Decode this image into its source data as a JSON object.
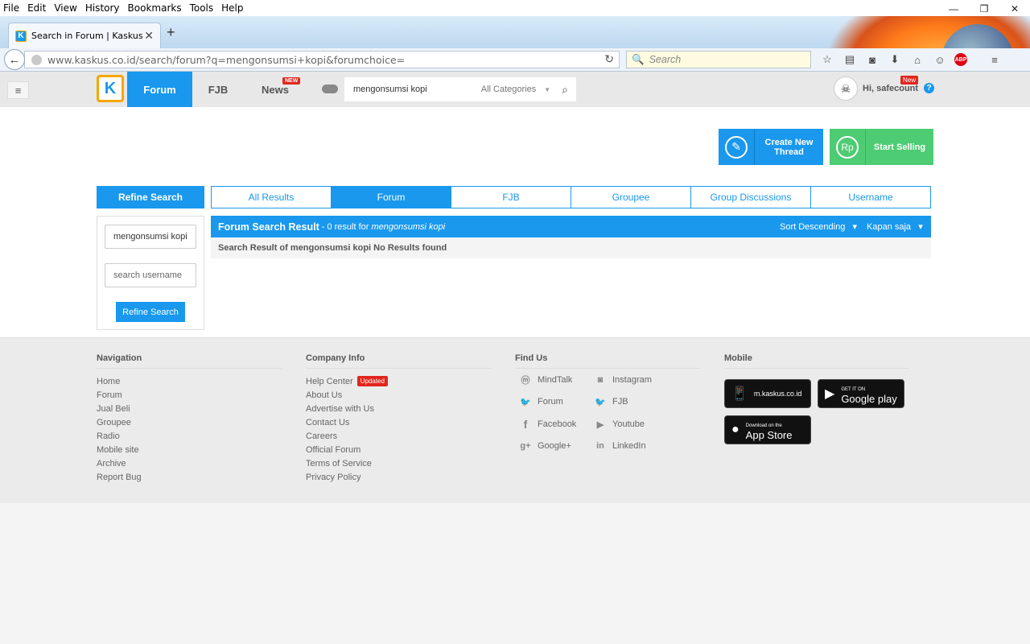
{
  "browser": {
    "menu": [
      "File",
      "Edit",
      "View",
      "History",
      "Bookmarks",
      "Tools",
      "Help"
    ],
    "tab_title": "Search in Forum | Kaskus -...",
    "url": "www.kaskus.co.id/search/forum?q=mengonsumsi+kopi&forumchoice=",
    "search_placeholder": "Search",
    "abp_label": "ABP"
  },
  "header": {
    "logo": "K",
    "nav": [
      "Forum",
      "FJB",
      "News"
    ],
    "new_badge": "NEW",
    "search_query": "mengonsumsi kopi",
    "category": "All Categories",
    "user_greeting": "Hi, safecount",
    "user_badge": "New",
    "help": "?"
  },
  "actions": {
    "create_thread": "Create New Thread",
    "start_selling": "Start Selling",
    "rp": "Rp"
  },
  "refine": {
    "title": "Refine Search",
    "query_value": "mengonsumsi kopi",
    "username_placeholder": "search username",
    "button": "Refine Search"
  },
  "result_tabs": [
    "All Results",
    "Forum",
    "FJB",
    "Groupee",
    "Group Discussions",
    "Username"
  ],
  "results": {
    "title": "Forum Search Result",
    "summary_prefix": "- 0 result for",
    "summary_query": "mengonsumsi kopi",
    "sort": "Sort Descending",
    "time": "Kapan saja",
    "message": "Search Result of mengonsumsi kopi No Results found"
  },
  "footer": {
    "navigation": {
      "title": "Navigation",
      "links": [
        "Home",
        "Forum",
        "Jual Beli",
        "Groupee",
        "Radio",
        "Mobile site",
        "Archive",
        "Report Bug"
      ]
    },
    "company": {
      "title": "Company Info",
      "links": [
        "Help Center",
        "About Us",
        "Advertise with Us",
        "Contact Us",
        "Careers",
        "Official Forum",
        "Terms of Service",
        "Privacy Policy"
      ],
      "updated_badge": "Updated"
    },
    "find_us": {
      "title": "Find Us",
      "left": [
        "MindTalk",
        "Forum",
        "Facebook",
        "Google+"
      ],
      "right": [
        "Instagram",
        "FJB",
        "Youtube",
        "LinkedIn"
      ]
    },
    "mobile": {
      "title": "Mobile",
      "site": "m.kaskus.co.id",
      "play_small": "GET IT ON",
      "play_big": "Google play",
      "store_small": "Download on the",
      "store_big": "App Store"
    }
  },
  "colors": {
    "accent": "#1998ed",
    "sell": "#4dcc73",
    "badge": "#e1261c"
  }
}
